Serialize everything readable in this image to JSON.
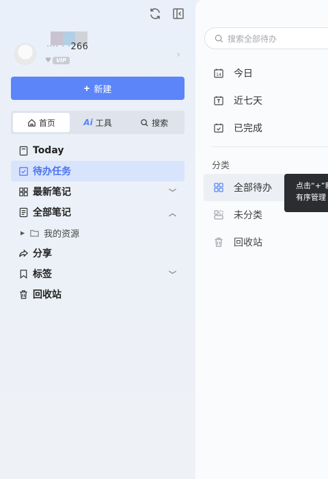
{
  "profile": {
    "username_suffix": "266",
    "vip_label": "VIP"
  },
  "new_button": {
    "plus": "+",
    "label": "新建"
  },
  "tabs": [
    {
      "label": "首页",
      "active": true
    },
    {
      "label": "工具",
      "prefix": "Ai"
    },
    {
      "label": "搜索"
    }
  ],
  "nav": {
    "today": "Today",
    "todo": "待办任务",
    "recent_notes": "最新笔记",
    "all_notes": "全部笔记",
    "my_resources": "我的资源",
    "share": "分享",
    "tags": "标签",
    "trash": "回收站"
  },
  "main": {
    "search_placeholder": "搜索全部待办",
    "today": "今日",
    "next7": "近七天",
    "done": "已完成",
    "section": "分类",
    "all_todo": "全部待办",
    "uncategorized": "未分类",
    "trash": "回收站",
    "today_icon_num": "14"
  },
  "tooltip": {
    "line1": "点击“+”新",
    "line2": "有序管理"
  },
  "colors": {
    "accent": "#5b85f8",
    "active_bg": "#d8e3fc",
    "tooltip_bg": "#2b2d31"
  }
}
